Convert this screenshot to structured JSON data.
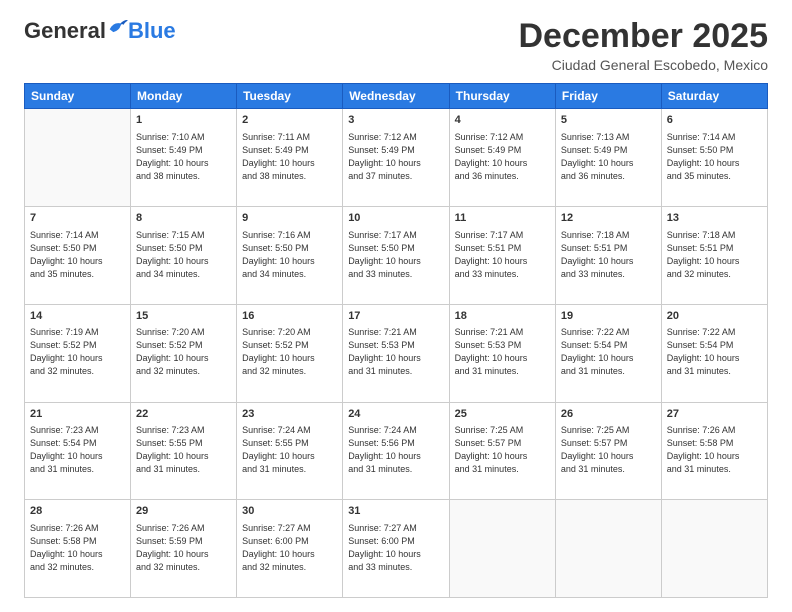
{
  "header": {
    "logo_general": "General",
    "logo_blue": "Blue",
    "month_title": "December 2025",
    "location": "Ciudad General Escobedo, Mexico"
  },
  "days_of_week": [
    "Sunday",
    "Monday",
    "Tuesday",
    "Wednesday",
    "Thursday",
    "Friday",
    "Saturday"
  ],
  "weeks": [
    [
      {
        "day": "",
        "info": ""
      },
      {
        "day": "1",
        "info": "Sunrise: 7:10 AM\nSunset: 5:49 PM\nDaylight: 10 hours\nand 38 minutes."
      },
      {
        "day": "2",
        "info": "Sunrise: 7:11 AM\nSunset: 5:49 PM\nDaylight: 10 hours\nand 38 minutes."
      },
      {
        "day": "3",
        "info": "Sunrise: 7:12 AM\nSunset: 5:49 PM\nDaylight: 10 hours\nand 37 minutes."
      },
      {
        "day": "4",
        "info": "Sunrise: 7:12 AM\nSunset: 5:49 PM\nDaylight: 10 hours\nand 36 minutes."
      },
      {
        "day": "5",
        "info": "Sunrise: 7:13 AM\nSunset: 5:49 PM\nDaylight: 10 hours\nand 36 minutes."
      },
      {
        "day": "6",
        "info": "Sunrise: 7:14 AM\nSunset: 5:50 PM\nDaylight: 10 hours\nand 35 minutes."
      }
    ],
    [
      {
        "day": "7",
        "info": "Sunrise: 7:14 AM\nSunset: 5:50 PM\nDaylight: 10 hours\nand 35 minutes."
      },
      {
        "day": "8",
        "info": "Sunrise: 7:15 AM\nSunset: 5:50 PM\nDaylight: 10 hours\nand 34 minutes."
      },
      {
        "day": "9",
        "info": "Sunrise: 7:16 AM\nSunset: 5:50 PM\nDaylight: 10 hours\nand 34 minutes."
      },
      {
        "day": "10",
        "info": "Sunrise: 7:17 AM\nSunset: 5:50 PM\nDaylight: 10 hours\nand 33 minutes."
      },
      {
        "day": "11",
        "info": "Sunrise: 7:17 AM\nSunset: 5:51 PM\nDaylight: 10 hours\nand 33 minutes."
      },
      {
        "day": "12",
        "info": "Sunrise: 7:18 AM\nSunset: 5:51 PM\nDaylight: 10 hours\nand 33 minutes."
      },
      {
        "day": "13",
        "info": "Sunrise: 7:18 AM\nSunset: 5:51 PM\nDaylight: 10 hours\nand 32 minutes."
      }
    ],
    [
      {
        "day": "14",
        "info": "Sunrise: 7:19 AM\nSunset: 5:52 PM\nDaylight: 10 hours\nand 32 minutes."
      },
      {
        "day": "15",
        "info": "Sunrise: 7:20 AM\nSunset: 5:52 PM\nDaylight: 10 hours\nand 32 minutes."
      },
      {
        "day": "16",
        "info": "Sunrise: 7:20 AM\nSunset: 5:52 PM\nDaylight: 10 hours\nand 32 minutes."
      },
      {
        "day": "17",
        "info": "Sunrise: 7:21 AM\nSunset: 5:53 PM\nDaylight: 10 hours\nand 31 minutes."
      },
      {
        "day": "18",
        "info": "Sunrise: 7:21 AM\nSunset: 5:53 PM\nDaylight: 10 hours\nand 31 minutes."
      },
      {
        "day": "19",
        "info": "Sunrise: 7:22 AM\nSunset: 5:54 PM\nDaylight: 10 hours\nand 31 minutes."
      },
      {
        "day": "20",
        "info": "Sunrise: 7:22 AM\nSunset: 5:54 PM\nDaylight: 10 hours\nand 31 minutes."
      }
    ],
    [
      {
        "day": "21",
        "info": "Sunrise: 7:23 AM\nSunset: 5:54 PM\nDaylight: 10 hours\nand 31 minutes."
      },
      {
        "day": "22",
        "info": "Sunrise: 7:23 AM\nSunset: 5:55 PM\nDaylight: 10 hours\nand 31 minutes."
      },
      {
        "day": "23",
        "info": "Sunrise: 7:24 AM\nSunset: 5:55 PM\nDaylight: 10 hours\nand 31 minutes."
      },
      {
        "day": "24",
        "info": "Sunrise: 7:24 AM\nSunset: 5:56 PM\nDaylight: 10 hours\nand 31 minutes."
      },
      {
        "day": "25",
        "info": "Sunrise: 7:25 AM\nSunset: 5:57 PM\nDaylight: 10 hours\nand 31 minutes."
      },
      {
        "day": "26",
        "info": "Sunrise: 7:25 AM\nSunset: 5:57 PM\nDaylight: 10 hours\nand 31 minutes."
      },
      {
        "day": "27",
        "info": "Sunrise: 7:26 AM\nSunset: 5:58 PM\nDaylight: 10 hours\nand 31 minutes."
      }
    ],
    [
      {
        "day": "28",
        "info": "Sunrise: 7:26 AM\nSunset: 5:58 PM\nDaylight: 10 hours\nand 32 minutes."
      },
      {
        "day": "29",
        "info": "Sunrise: 7:26 AM\nSunset: 5:59 PM\nDaylight: 10 hours\nand 32 minutes."
      },
      {
        "day": "30",
        "info": "Sunrise: 7:27 AM\nSunset: 6:00 PM\nDaylight: 10 hours\nand 32 minutes."
      },
      {
        "day": "31",
        "info": "Sunrise: 7:27 AM\nSunset: 6:00 PM\nDaylight: 10 hours\nand 33 minutes."
      },
      {
        "day": "",
        "info": ""
      },
      {
        "day": "",
        "info": ""
      },
      {
        "day": "",
        "info": ""
      }
    ]
  ]
}
